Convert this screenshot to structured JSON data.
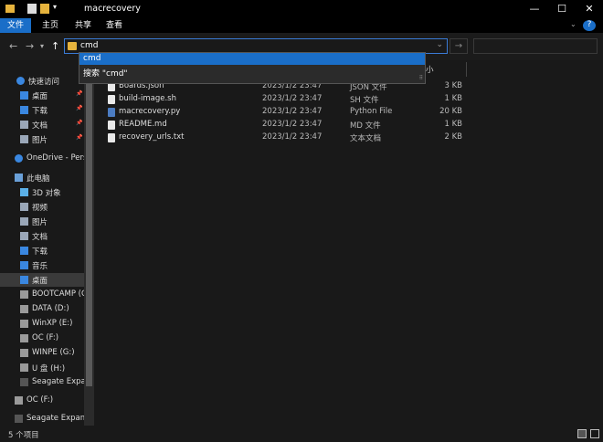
{
  "window": {
    "title": "macrecovery",
    "minimize": "—",
    "maximize": "☐",
    "close": "✕"
  },
  "ribbon": {
    "tabs": [
      "文件",
      "主页",
      "共享",
      "查看"
    ],
    "help": "?"
  },
  "address": {
    "value": "cmd",
    "refresh": "→"
  },
  "dropdown": {
    "item1": "cmd",
    "item2": "搜索 \"cmd\"",
    "grip": "⠿"
  },
  "header": {
    "size_partial": "小"
  },
  "sidebar": {
    "items": [
      {
        "label": "快速访问",
        "icon": "star-icon",
        "pin": false
      },
      {
        "label": "桌面",
        "icon": "desktop-icon",
        "pin": true
      },
      {
        "label": "下载",
        "icon": "download-icon",
        "pin": true
      },
      {
        "label": "文档",
        "icon": "documents-icon",
        "pin": true
      },
      {
        "label": "图片",
        "icon": "pictures-icon",
        "pin": true
      },
      {
        "label": "OneDrive - Perso",
        "icon": "cloud-icon",
        "pin": false
      },
      {
        "label": "此电脑",
        "icon": "computer-icon",
        "pin": false
      },
      {
        "label": "3D 对象",
        "icon": "3d-objects-icon",
        "pin": false
      },
      {
        "label": "视频",
        "icon": "videos-icon",
        "pin": false
      },
      {
        "label": "图片",
        "icon": "pictures-icon",
        "pin": false
      },
      {
        "label": "文档",
        "icon": "documents-icon",
        "pin": false
      },
      {
        "label": "下载",
        "icon": "download-icon",
        "pin": false
      },
      {
        "label": "音乐",
        "icon": "music-icon",
        "pin": false
      },
      {
        "label": "桌面",
        "icon": "desktop-icon",
        "pin": false,
        "selected": true
      },
      {
        "label": "BOOTCAMP (C",
        "icon": "drive-icon",
        "pin": false
      },
      {
        "label": "DATA (D:)",
        "icon": "drive-icon",
        "pin": false
      },
      {
        "label": "WinXP  (E:)",
        "icon": "drive-icon",
        "pin": false
      },
      {
        "label": "OC (F:)",
        "icon": "drive-icon",
        "pin": false
      },
      {
        "label": "WINPE (G:)",
        "icon": "drive-icon",
        "pin": false
      },
      {
        "label": "U 盘 (H:)",
        "icon": "drive-icon",
        "pin": false
      },
      {
        "label": "Seagate Expan",
        "icon": "external-drive-icon",
        "pin": false
      },
      {
        "label": "OC (F:)",
        "icon": "drive-icon",
        "pin": false
      },
      {
        "label": "Seagate Expansi",
        "icon": "external-drive-icon",
        "pin": false
      }
    ]
  },
  "files": [
    {
      "name": "Boards.json",
      "date": "2023/1/2 23:47",
      "type": "JSON 文件",
      "size": "3 KB"
    },
    {
      "name": "build-image.sh",
      "date": "2023/1/2 23:47",
      "type": "SH 文件",
      "size": "1 KB"
    },
    {
      "name": "macrecovery.py",
      "date": "2023/1/2 23:47",
      "type": "Python File",
      "size": "20 KB"
    },
    {
      "name": "README.md",
      "date": "2023/1/2 23:47",
      "type": "MD 文件",
      "size": "1 KB"
    },
    {
      "name": "recovery_urls.txt",
      "date": "2023/1/2 23:47",
      "type": "文本文档",
      "size": "2 KB"
    }
  ],
  "status": {
    "count": "5 个项目"
  }
}
